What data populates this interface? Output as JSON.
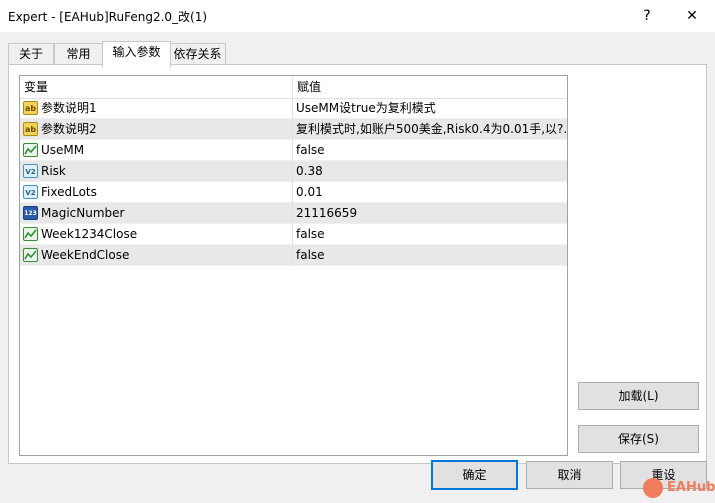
{
  "window": {
    "title": "Expert - [EAHub]RuFeng2.0_改(1)",
    "help_label": "?",
    "close_label": "✕"
  },
  "tabs": [
    {
      "label": "关于",
      "active": false
    },
    {
      "label": "常用",
      "active": false
    },
    {
      "label": "输入参数",
      "active": true
    },
    {
      "label": "依存关系",
      "active": false
    }
  ],
  "grid": {
    "headers": {
      "variable": "变量",
      "value": "赋值"
    },
    "rows": [
      {
        "icon": "string-type-icon",
        "name": "参数说明1",
        "value": "UseMM设true为复利模式"
      },
      {
        "icon": "string-type-icon",
        "name": "参数说明2",
        "value": "复利模式时,如账户500美金,Risk0.4为0.01手,以?.."
      },
      {
        "icon": "bool-type-icon",
        "name": "UseMM",
        "value": "false"
      },
      {
        "icon": "double-type-icon",
        "name": "Risk",
        "value": "0.38"
      },
      {
        "icon": "double-type-icon",
        "name": "FixedLots",
        "value": "0.01"
      },
      {
        "icon": "int-type-icon",
        "name": "MagicNumber",
        "value": "21116659"
      },
      {
        "icon": "bool-type-icon",
        "name": "Week1234Close",
        "value": "false"
      },
      {
        "icon": "bool-type-icon",
        "name": "WeekEndClose",
        "value": "false"
      }
    ]
  },
  "icon_text": {
    "string": "ab",
    "double": "V2",
    "int": "123"
  },
  "buttons": {
    "load": "加载(L)",
    "save": "保存(S)",
    "ok": "确定",
    "cancel": "取消",
    "reset": "重设"
  },
  "watermark": {
    "text": "EAHub"
  },
  "colors": {
    "accent": "#0078d7",
    "alt_row": "#e8e8e8",
    "watermark": "#f07c5c"
  }
}
